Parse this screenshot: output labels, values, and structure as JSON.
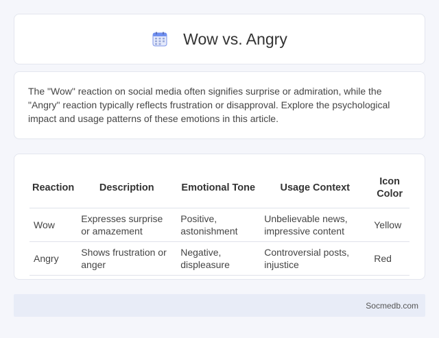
{
  "header": {
    "title": "Wow vs. Angry",
    "icon": "calendar-icon",
    "icon_color": "#6f8ff0"
  },
  "intro": {
    "text": "The \"Wow\" reaction on social media often signifies surprise or admiration, while the \"Angry\" reaction typically reflects frustration or disapproval. Explore the psychological impact and usage patterns of these emotions in this article."
  },
  "table": {
    "headers": [
      "Reaction",
      "Description",
      "Emotional Tone",
      "Usage Context",
      "Icon Color"
    ],
    "rows": [
      [
        "Wow",
        "Expresses surprise or amazement",
        "Positive, astonishment",
        "Unbelievable news, impressive content",
        "Yellow"
      ],
      [
        "Angry",
        "Shows frustration or anger",
        "Negative, displeasure",
        "Controversial posts, injustice",
        "Red"
      ]
    ]
  },
  "footer": {
    "brand": "Socmedb.com"
  }
}
